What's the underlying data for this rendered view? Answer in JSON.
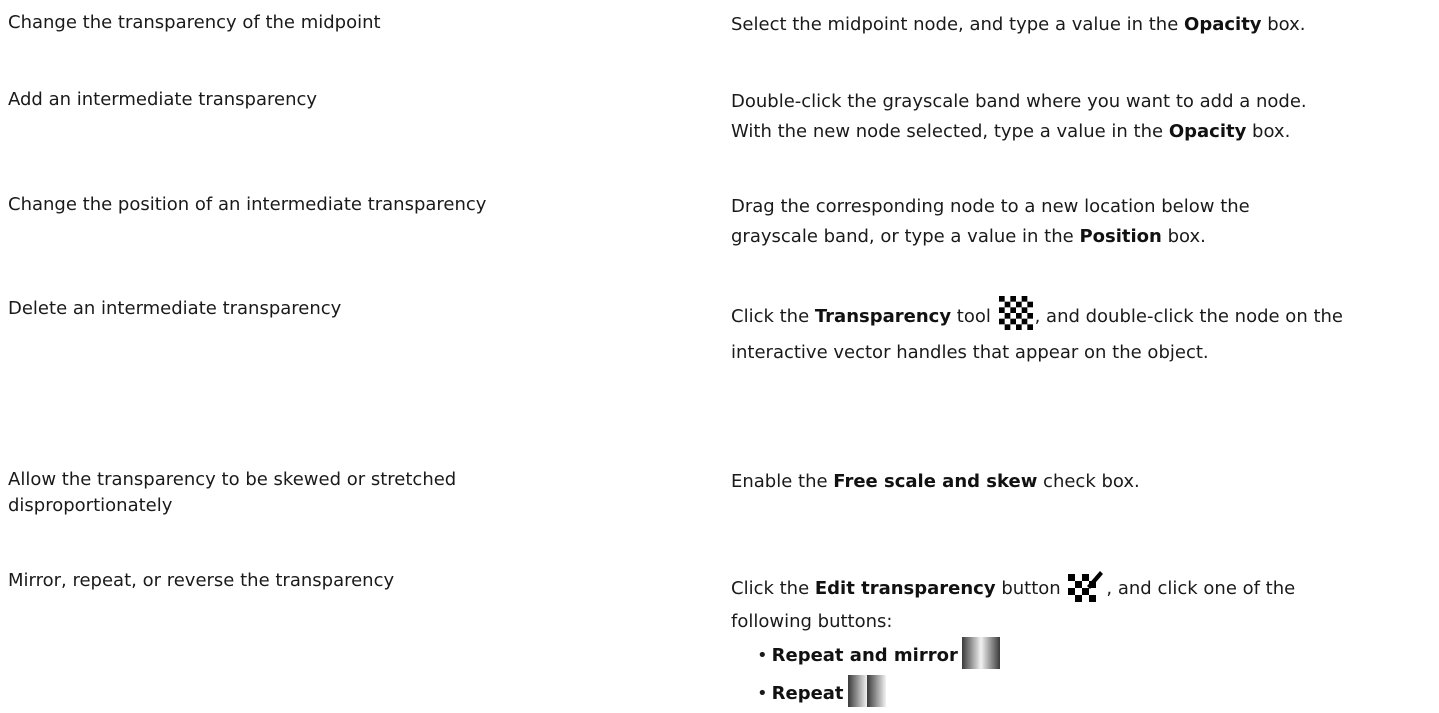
{
  "rows": [
    {
      "task": "Change the transparency of the midpoint",
      "action": {
        "pre": "Select the midpoint node, and type a value in the ",
        "kw": "Opacity",
        "post": " box."
      }
    },
    {
      "task": "Add an intermediate transparency",
      "action": {
        "line1": "Double-click the grayscale band where you want to add a node.",
        "pre": "With the new node selected, type a value in the ",
        "kw": "Opacity",
        "post": " box."
      }
    },
    {
      "task": "Change the position of an intermediate transparency",
      "action": {
        "line1": "Drag the corresponding node to a new location below the",
        "pre": "grayscale band, or type a value in the ",
        "kw": "Position",
        "post": " box."
      }
    },
    {
      "task": "Delete an intermediate transparency",
      "action": {
        "pre": "Click the ",
        "kw": "Transparency",
        "mid": " tool ",
        "post": ", and double-click the node on the",
        "line2": "interactive vector handles that appear on the object."
      }
    },
    {
      "task_line1": "Allow the transparency to be skewed or stretched",
      "task_line2": "disproportionately",
      "action": {
        "pre": "Enable the ",
        "kw": "Free scale and skew",
        "post": " check box."
      }
    },
    {
      "task": "Mirror, repeat, or reverse the transparency",
      "action": {
        "pre": "Click the ",
        "kw": "Edit transparency",
        "mid": " button ",
        "post": ", and click one of the",
        "line2": "following buttons:"
      },
      "options": [
        "Repeat and mirror",
        "Repeat"
      ]
    }
  ],
  "icons": {
    "transparency_tool": "checkerboard-icon",
    "edit_transparency": "checkerboard-pen-icon",
    "repeat_and_mirror": "gradient-mirror-icon",
    "repeat": "gradient-repeat-icon"
  }
}
